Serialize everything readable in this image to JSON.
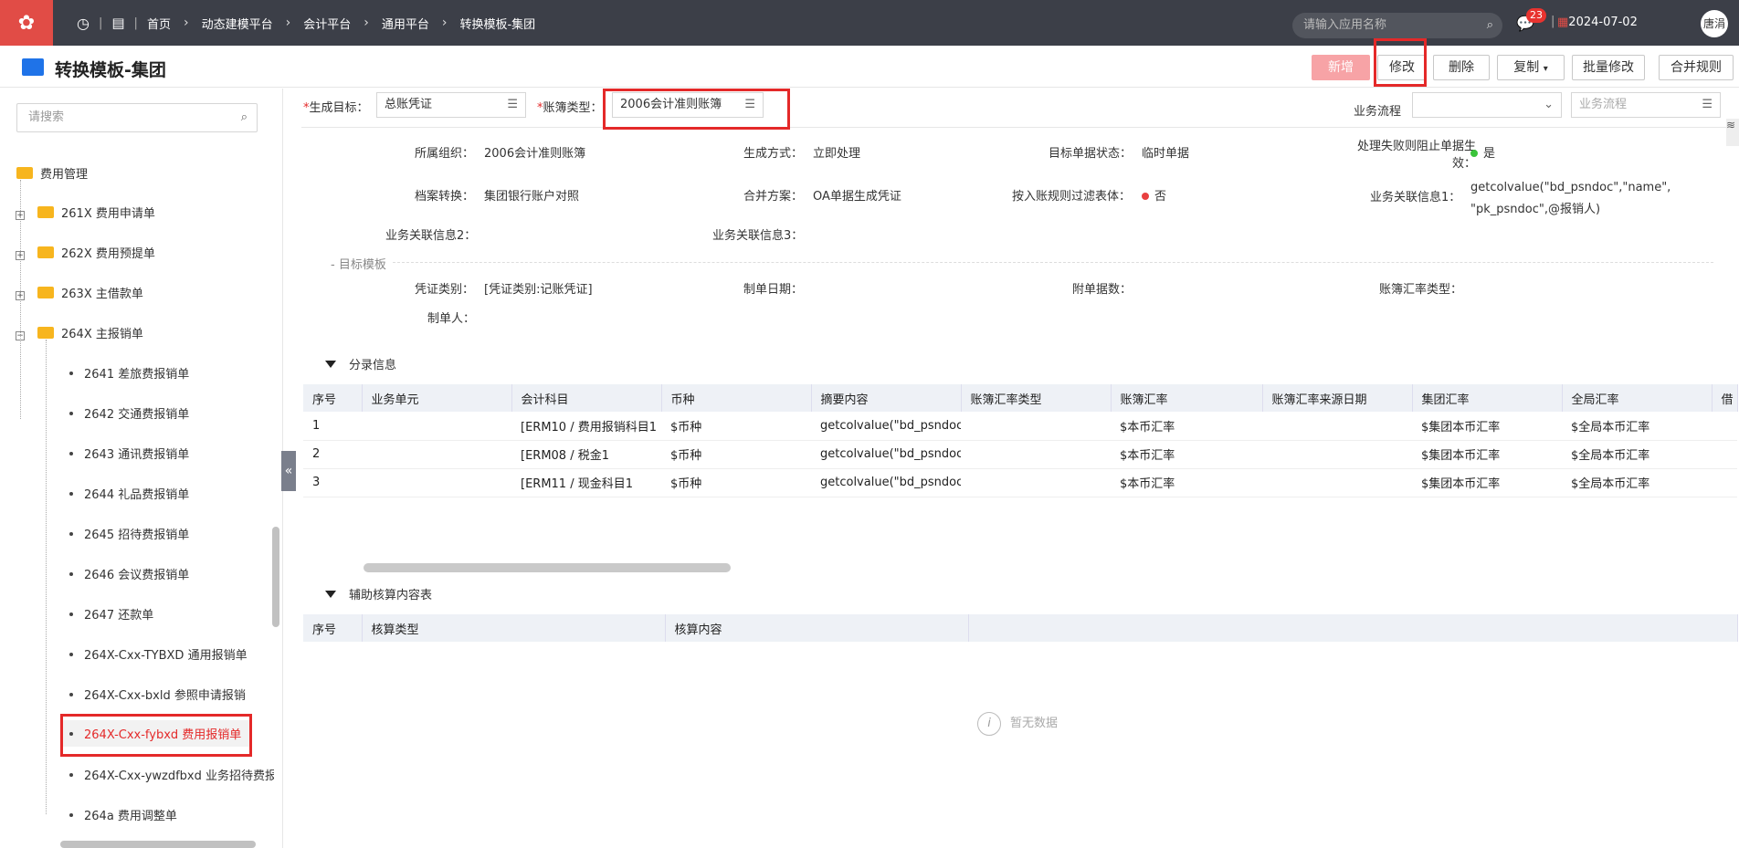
{
  "topbar": {
    "logo": "✿",
    "breadcrumbs": [
      "首页",
      "动态建模平台",
      "会计平台",
      "通用平台",
      "转换模板-集团"
    ],
    "search_placeholder": "请输入应用名称",
    "message_count": "23",
    "date": "2024-07-02",
    "user": "唐涓"
  },
  "header": {
    "title": "转换模板-集团",
    "buttons": {
      "add": "新增",
      "edit": "修改",
      "delete": "删除",
      "copy": "复制",
      "batch_edit": "批量修改",
      "merge_rule": "合并规则"
    }
  },
  "sidebar": {
    "search_placeholder": "请搜索",
    "root": "费用管理",
    "folders": [
      {
        "label": "261X 费用申请单",
        "toggle": "+"
      },
      {
        "label": "262X 费用预提单",
        "toggle": "+"
      },
      {
        "label": "263X 主借款单",
        "toggle": "+"
      },
      {
        "label": "264X 主报销单",
        "toggle": "−"
      }
    ],
    "children": [
      "2641 差旅费报销单",
      "2642 交通费报销单",
      "2643 通讯费报销单",
      "2644 礼品费报销单",
      "2645 招待费报销单",
      "2646 会议费报销单",
      "2647 还款单",
      "264X-Cxx-TYBXD 通用报销单",
      "264X-Cxx-bxld 参照申请报销",
      "264X-Cxx-fybxd 费用报销单",
      "264X-Cxx-ywzdfbxd 业务招待费报销",
      "264a 费用调整单"
    ]
  },
  "filters": {
    "target_label": "生成目标：",
    "target_value": "总账凭证",
    "book_type_label": "账簿类型：",
    "book_type_value": "2006会计准则账簿",
    "biz_flow_label": "业务流程",
    "biz_flow_placeholder": "业务流程"
  },
  "info": {
    "org_label": "所属组织：",
    "org_value": "2006会计准则账簿",
    "gen_mode_label": "生成方式：",
    "gen_mode_value": "立即处理",
    "target_status_label": "目标单据状态：",
    "target_status_value": "临时单据",
    "fail_block_label_1": "处理失败则阻止单据生",
    "fail_block_label_2": "效：",
    "fail_block_value": "是",
    "archive_label": "档案转换：",
    "archive_value": "集团银行账户对照",
    "merge_label": "合并方案：",
    "merge_value": "OA单据生成凭证",
    "filter_label": "按入账规则过滤表体：",
    "filter_value": "否",
    "rel1_label": "业务关联信息1：",
    "rel1_value_1": "getcolvalue(\"bd_psndoc\",\"name\",",
    "rel1_value_2": "\"pk_psndoc\",@报销人)",
    "rel2_label": "业务关联信息2：",
    "rel3_label": "业务关联信息3："
  },
  "target_template": {
    "section": "目标模板",
    "voucher_type_label": "凭证类别：",
    "voucher_type_value": "[凭证类别:记账凭证]",
    "date_label": "制单日期：",
    "attach_label": "附单据数：",
    "rate_type_label": "账簿汇率类型：",
    "maker_label": "制单人："
  },
  "entries": {
    "title": "分录信息",
    "columns": [
      "序号",
      "业务单元",
      "会计科目",
      "币种",
      "摘要内容",
      "账簿汇率类型",
      "账簿汇率",
      "账簿汇率来源日期",
      "集团汇率",
      "全局汇率",
      "借"
    ],
    "rows": [
      [
        "1",
        "",
        "[ERM10 / 费用报销科目1",
        "$币种",
        "getcolvalue(\"bd_psndoc...",
        "",
        "$本币汇率",
        "",
        "$集团本币汇率",
        "$全局本币汇率"
      ],
      [
        "2",
        "",
        "[ERM08 / 税金1",
        "$币种",
        "getcolvalue(\"bd_psndoc...",
        "",
        "$本币汇率",
        "",
        "$集团本币汇率",
        "$全局本币汇率"
      ],
      [
        "3",
        "",
        "[ERM11 / 现金科目1",
        "$币种",
        "getcolvalue(\"bd_psndoc...",
        "",
        "$本币汇率",
        "",
        "$集团本币汇率",
        "$全局本币汇率"
      ]
    ]
  },
  "aux": {
    "title": "辅助核算内容表",
    "columns": [
      "序号",
      "核算类型",
      "核算内容"
    ],
    "empty": "暂无数据"
  },
  "colors": {
    "topbar": "#3c3f48",
    "brand": "#e14c46",
    "highlight": "#e42929",
    "primary_disabled": "#f7a3a6"
  }
}
